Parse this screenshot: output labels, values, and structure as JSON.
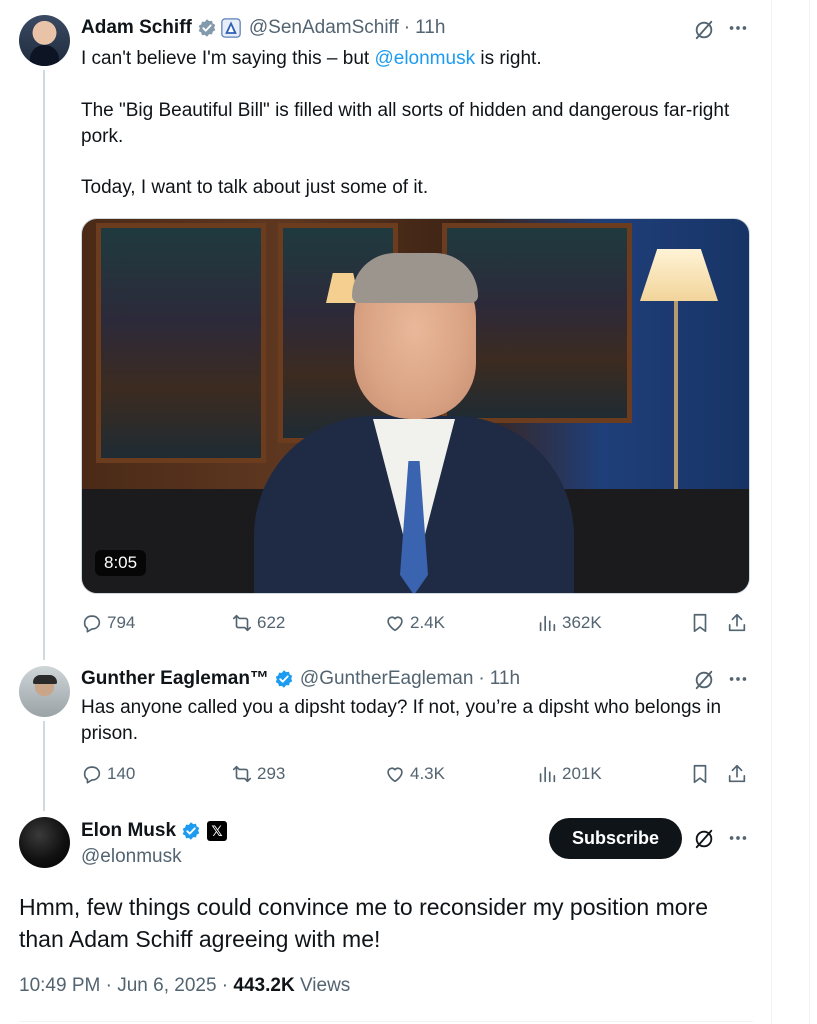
{
  "tweets": [
    {
      "name": "Adam Schiff",
      "handle": "@SenAdamSchiff",
      "time": "11h",
      "text_line1_prefix": "I can't believe I'm saying this – but ",
      "text_line1_mention": "@elonmusk",
      "text_line1_suffix": " is right.",
      "text_para2": "The \"Big Beautiful Bill\" is filled with all sorts of hidden and dangerous far-right pork.",
      "text_para3": "Today, I want to talk about just some of it.",
      "video_duration": "8:05",
      "replies": "794",
      "reposts": "622",
      "likes": "2.4K",
      "views": "362K"
    },
    {
      "name": "Gunther Eagleman™",
      "handle": "@GuntherEagleman",
      "time": "11h",
      "text": "Has anyone called you a dipsht today?  If not, you’re a dipsht who belongs in prison.",
      "replies": "140",
      "reposts": "293",
      "likes": "4.3K",
      "views": "201K"
    }
  ],
  "main_post": {
    "name": "Elon Musk",
    "handle": "@elonmusk",
    "subscribe_label": "Subscribe",
    "text": "Hmm, few things could convince me to reconsider my position more than Adam Schiff agreeing with me!",
    "timestamp": "10:49 PM · Jun 6, 2025",
    "views_count": "443.2K",
    "views_label": "Views"
  },
  "colors": {
    "accent": "#1d9bf0",
    "text": "#0f1419",
    "muted": "#536471",
    "verified": "#1d9bf0"
  },
  "icons": [
    "verified-badge-icon",
    "government-badge-icon",
    "x-logo-icon",
    "grok-icon",
    "more-icon",
    "reply-icon",
    "repost-icon",
    "like-icon",
    "views-icon",
    "bookmark-icon",
    "share-icon"
  ]
}
